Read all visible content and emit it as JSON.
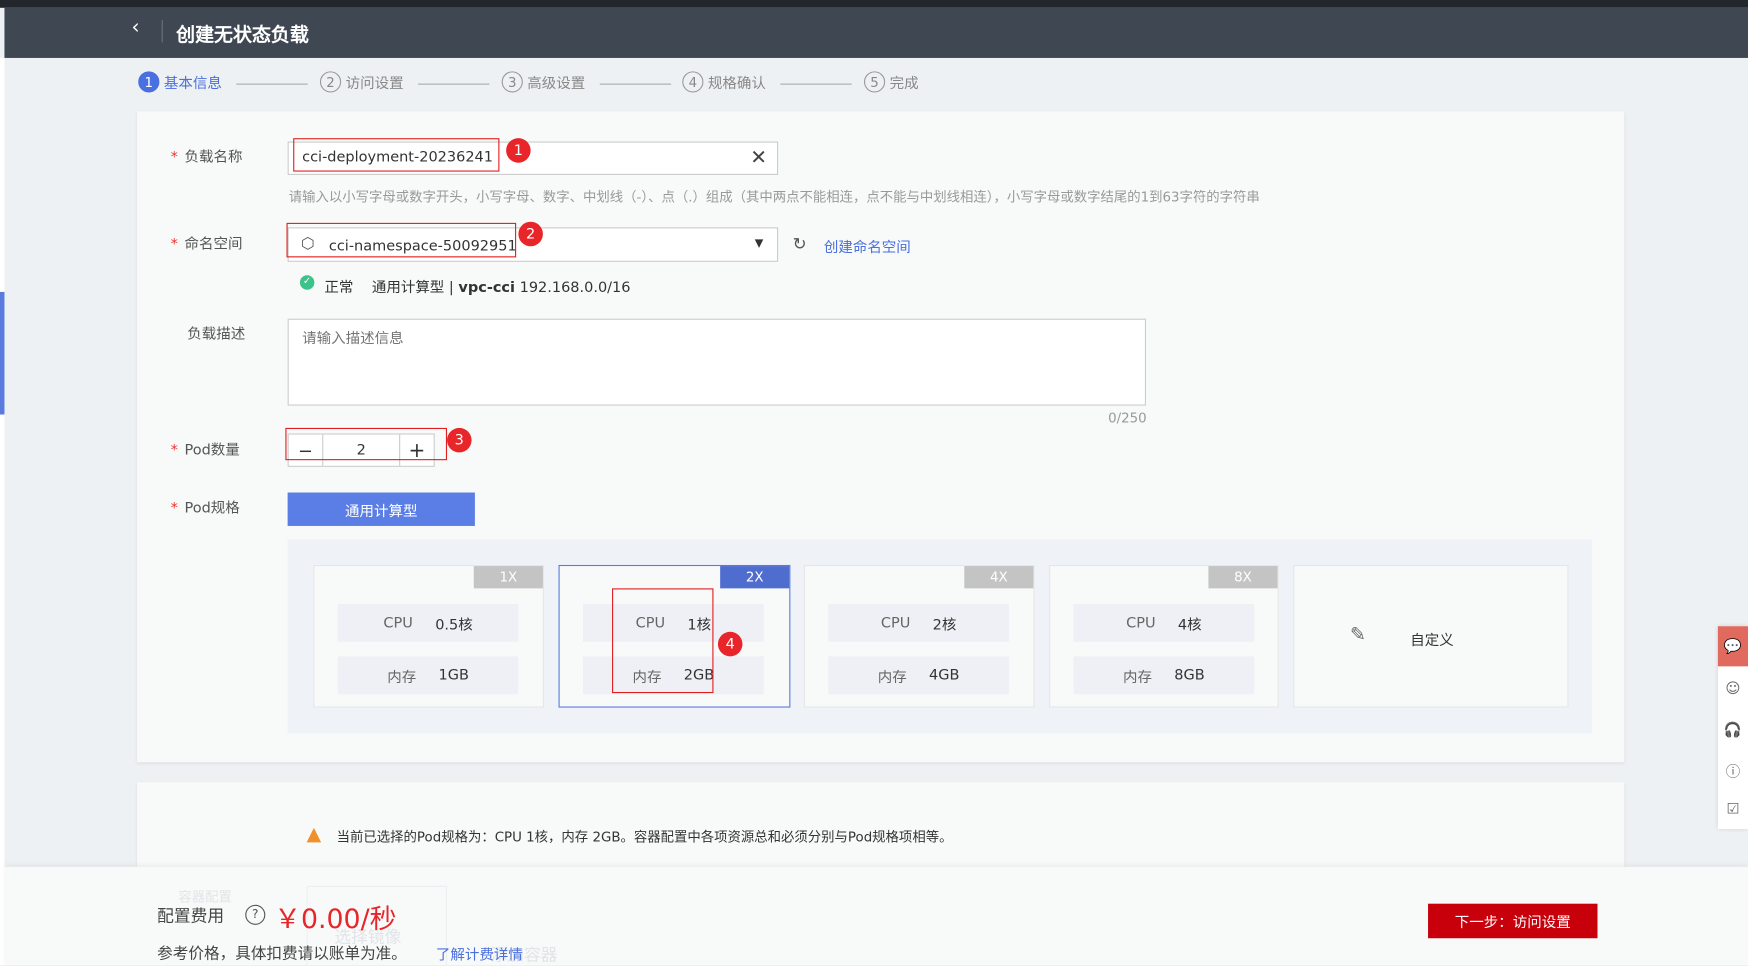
{
  "header": {
    "title": "创建无状态负载",
    "back_icon": "chevron-left-icon"
  },
  "steps": [
    {
      "num": "1",
      "label": "基本信息"
    },
    {
      "num": "2",
      "label": "访问设置"
    },
    {
      "num": "3",
      "label": "高级设置"
    },
    {
      "num": "4",
      "label": "规格确认"
    },
    {
      "num": "5",
      "label": "完成"
    }
  ],
  "form": {
    "name_label": "负载名称",
    "name_value": "cci-deployment-20236241",
    "name_hint": "请输入以小写字母或数字开头，小写字母、数字、中划线（-）、点（.）组成（其中两点不能相连，点不能与中划线相连），小写字母或数字结尾的1到63字符的字符串",
    "ns_label": "命名空间",
    "ns_value": "cci-namespace-50092951",
    "ns_create": "创建命名空间",
    "ns_status": "正常",
    "ns_type": "通用计算型 | ",
    "ns_vpc": "vpc-cci",
    "ns_cidr": " 192.168.0.0/16",
    "desc_label": "负载描述",
    "desc_placeholder": "请输入描述信息",
    "desc_count": "0/250",
    "pod_count_label": "Pod数量",
    "pod_count": "2",
    "minus": "−",
    "plus": "+",
    "pod_spec_label": "Pod规格",
    "pod_spec_tab": "通用计算型"
  },
  "badges": [
    "1",
    "2",
    "3",
    "4"
  ],
  "specs": [
    {
      "tag": "1X",
      "cpu_label": "CPU",
      "cpu": "0.5核",
      "mem_label": "内存",
      "mem": "1GB"
    },
    {
      "tag": "2X",
      "cpu_label": "CPU",
      "cpu": "1核",
      "mem_label": "内存",
      "mem": "2GB"
    },
    {
      "tag": "4X",
      "cpu_label": "CPU",
      "cpu": "2核",
      "mem_label": "内存",
      "mem": "4GB"
    },
    {
      "tag": "8X",
      "cpu_label": "CPU",
      "cpu": "4核",
      "mem_label": "内存",
      "mem": "8GB"
    }
  ],
  "custom_label": "自定义",
  "warning": "当前已选择的Pod规格为：CPU 1核，内存 2GB。容器配置中各项资源总和必须分别与Pod规格项相等。",
  "ghost": {
    "container_config": "容器配置",
    "select_image": "选择镜像",
    "add_container": "添加容器"
  },
  "footer": {
    "fee_label": "配置费用",
    "price": "￥0.00/秒",
    "note": "参考价格，具体扣费请以账单为准。",
    "link": "了解计费详情",
    "next": "下一步：访问设置"
  },
  "colors": {
    "accent": "#4a6fe0",
    "danger": "#c7000b",
    "price": "#e8262a"
  }
}
